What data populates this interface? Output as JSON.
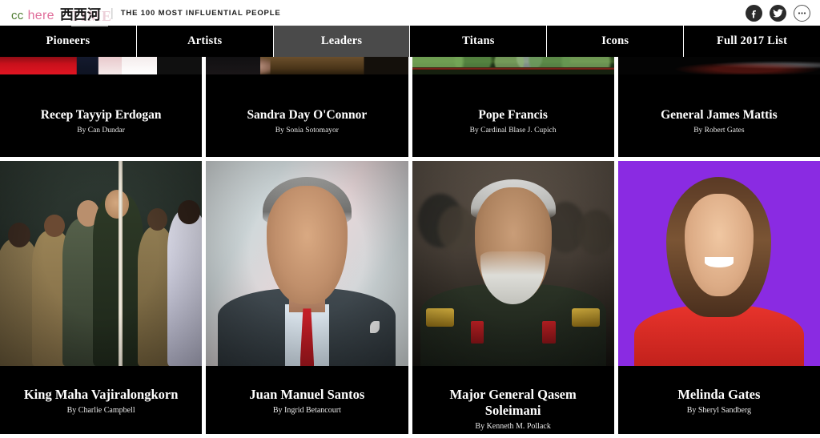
{
  "header": {
    "brand_cc": "cc",
    "brand_here": "here",
    "brand_cn": "西西河",
    "watermark": "TIME",
    "separator": "|",
    "tagline": "THE 100 MOST INFLUENTIAL PEOPLE",
    "social": [
      {
        "name": "facebook",
        "label": "f"
      },
      {
        "name": "twitter",
        "label": "t"
      },
      {
        "name": "more",
        "label": "···"
      }
    ]
  },
  "nav": {
    "items": [
      {
        "label": "Pioneers",
        "active": false
      },
      {
        "label": "Artists",
        "active": false
      },
      {
        "label": "Leaders",
        "active": true
      },
      {
        "label": "Titans",
        "active": false
      },
      {
        "label": "Icons",
        "active": false
      },
      {
        "label": "Full 2017 List",
        "active": false
      }
    ]
  },
  "grid": {
    "row1": [
      {
        "name": "Recep Tayyip Erdogan",
        "author": "By Can Dundar"
      },
      {
        "name": "Sandra Day O'Connor",
        "author": "By Sonia Sotomayor"
      },
      {
        "name": "Pope Francis",
        "author": "By Cardinal Blase J. Cupich"
      },
      {
        "name": "General James Mattis",
        "author": "By Robert Gates"
      }
    ],
    "row2": [
      {
        "name": "King Maha Vajiralongkorn",
        "author": "By Charlie Campbell"
      },
      {
        "name": "Juan Manuel Santos",
        "author": "By Ingrid Betancourt"
      },
      {
        "name": "Major General Qasem Soleimani",
        "author": "By Kenneth M. Pollack"
      },
      {
        "name": "Melinda Gates",
        "author": "By Sheryl Sandberg"
      }
    ]
  },
  "colors": {
    "nav_background": "#000000",
    "nav_active": "#4a4a4a",
    "card_background": "#000000",
    "page_background": "#ffffff",
    "brand_green": "#4c7a2e",
    "brand_pink": "#e06d9a",
    "melinda_backdrop": "#8a2be2"
  }
}
